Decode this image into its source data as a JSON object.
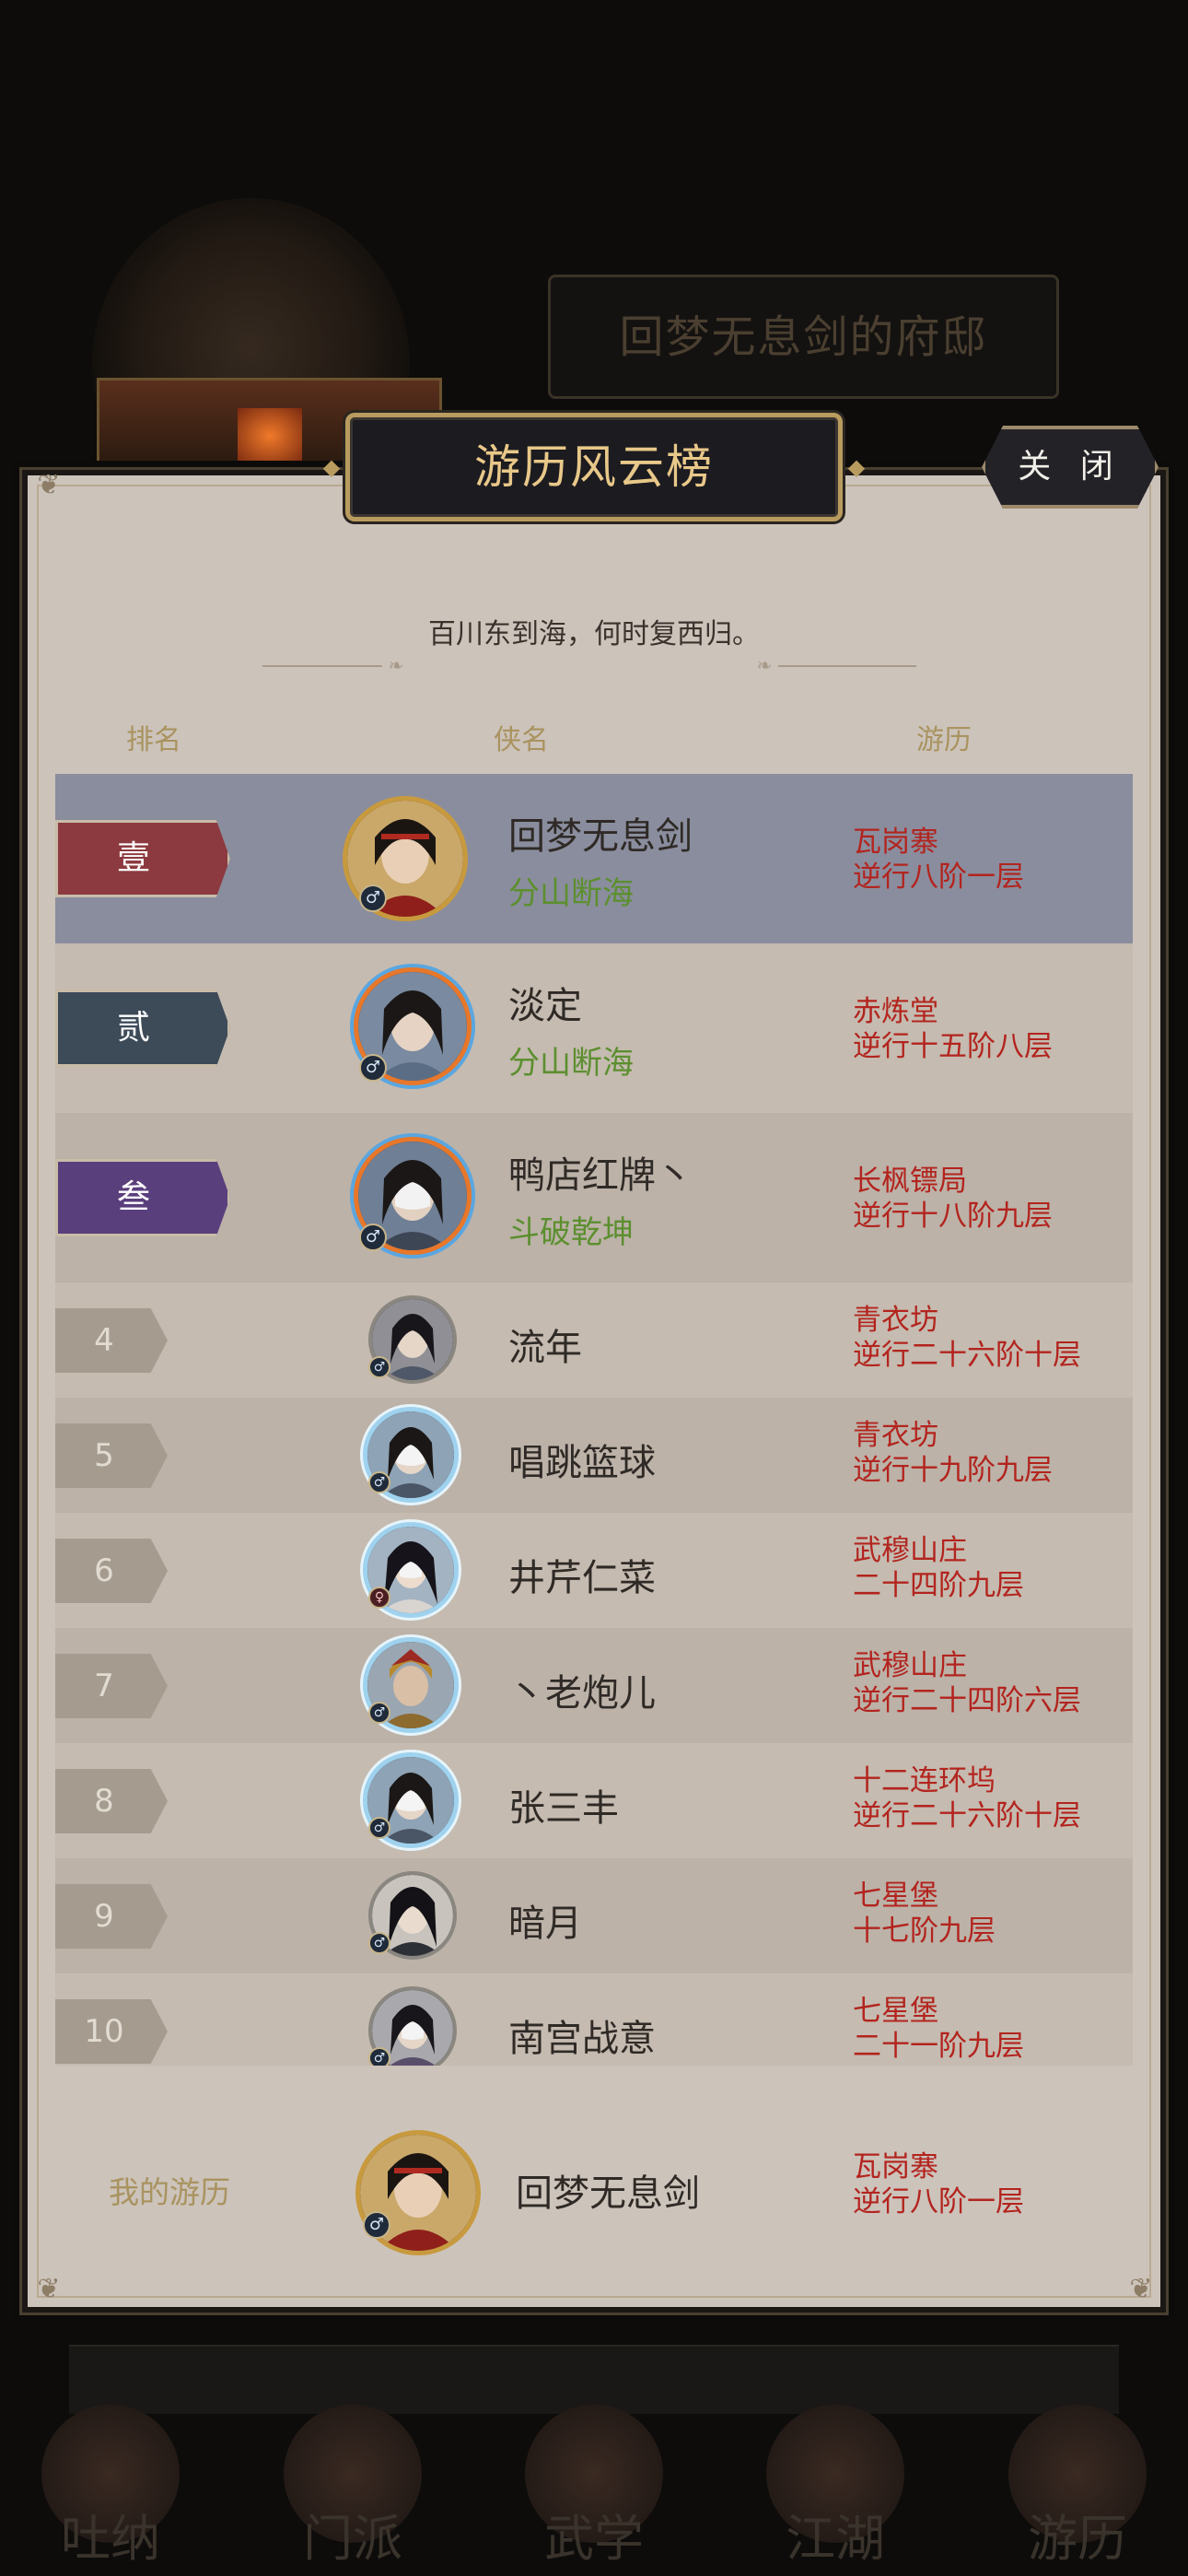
{
  "background": {
    "residence_title": "回梦无息剑的府邸",
    "nav_items": [
      "吐纳",
      "门派",
      "武学",
      "江湖",
      "游历"
    ]
  },
  "modal": {
    "title": "游历风云榜",
    "close_label": "关 闭",
    "motto": "百川东到海，何时复西归。",
    "columns": {
      "rank": "排名",
      "name": "侠名",
      "travel": "游历"
    }
  },
  "colors": {
    "rank1_badge": "#8c3a3f",
    "rank2_badge": "#3d4a58",
    "rank3_badge": "#5a3f7d",
    "row_highlight": "#8a8d9d",
    "place_text": "#b3241e",
    "title_text": "#5c8f2f",
    "header_gold": "#a9935f"
  },
  "rows": [
    {
      "rank": "壹",
      "name": "回梦无息剑",
      "title": "分山断海",
      "sect": "瓦岗寨",
      "stage": "逆行八阶一层",
      "avatar": "gold-dragon-frame-avatar-icon"
    },
    {
      "rank": "贰",
      "name": "淡定",
      "title": "分山断海",
      "sect": "赤炼堂",
      "stage": "逆行十五阶八层",
      "avatar": "fire-ice-frame-avatar-icon"
    },
    {
      "rank": "叁",
      "name": "鸭店红牌丶",
      "title": "斗破乾坤",
      "sect": "长枫镖局",
      "stage": "逆行十八阶九层",
      "avatar": "fire-ice-frame-avatar-icon"
    },
    {
      "rank": "4",
      "name": "流年",
      "sect": "青衣坊",
      "stage": "逆行二十六阶十层",
      "avatar": "silver-frame-avatar-icon"
    },
    {
      "rank": "5",
      "name": "唱跳篮球",
      "sect": "青衣坊",
      "stage": "逆行十九阶九层",
      "avatar": "ice-frame-avatar-icon"
    },
    {
      "rank": "6",
      "name": "井芹仁菜",
      "sect": "武穆山庄",
      "stage": "二十四阶九层",
      "avatar": "ice-frame-avatar-icon"
    },
    {
      "rank": "7",
      "name": "丶老炮儿",
      "sect": "武穆山庄",
      "stage": "逆行二十四阶六层",
      "avatar": "ice-frame-avatar-icon"
    },
    {
      "rank": "8",
      "name": "张三丰",
      "sect": "十二连环坞",
      "stage": "逆行二十六阶十层",
      "avatar": "ice-frame-avatar-icon"
    },
    {
      "rank": "9",
      "name": "暗月",
      "sect": "七星堡",
      "stage": "十七阶九层",
      "avatar": "silver-frame-avatar-icon"
    },
    {
      "rank": "10",
      "name": "南宫战意",
      "sect": "七星堡",
      "stage": "二十一阶九层",
      "avatar": "silver-frame-avatar-icon"
    }
  ],
  "mine": {
    "label": "我的游历",
    "name": "回梦无息剑",
    "sect": "瓦岗寨",
    "stage": "逆行八阶一层"
  }
}
